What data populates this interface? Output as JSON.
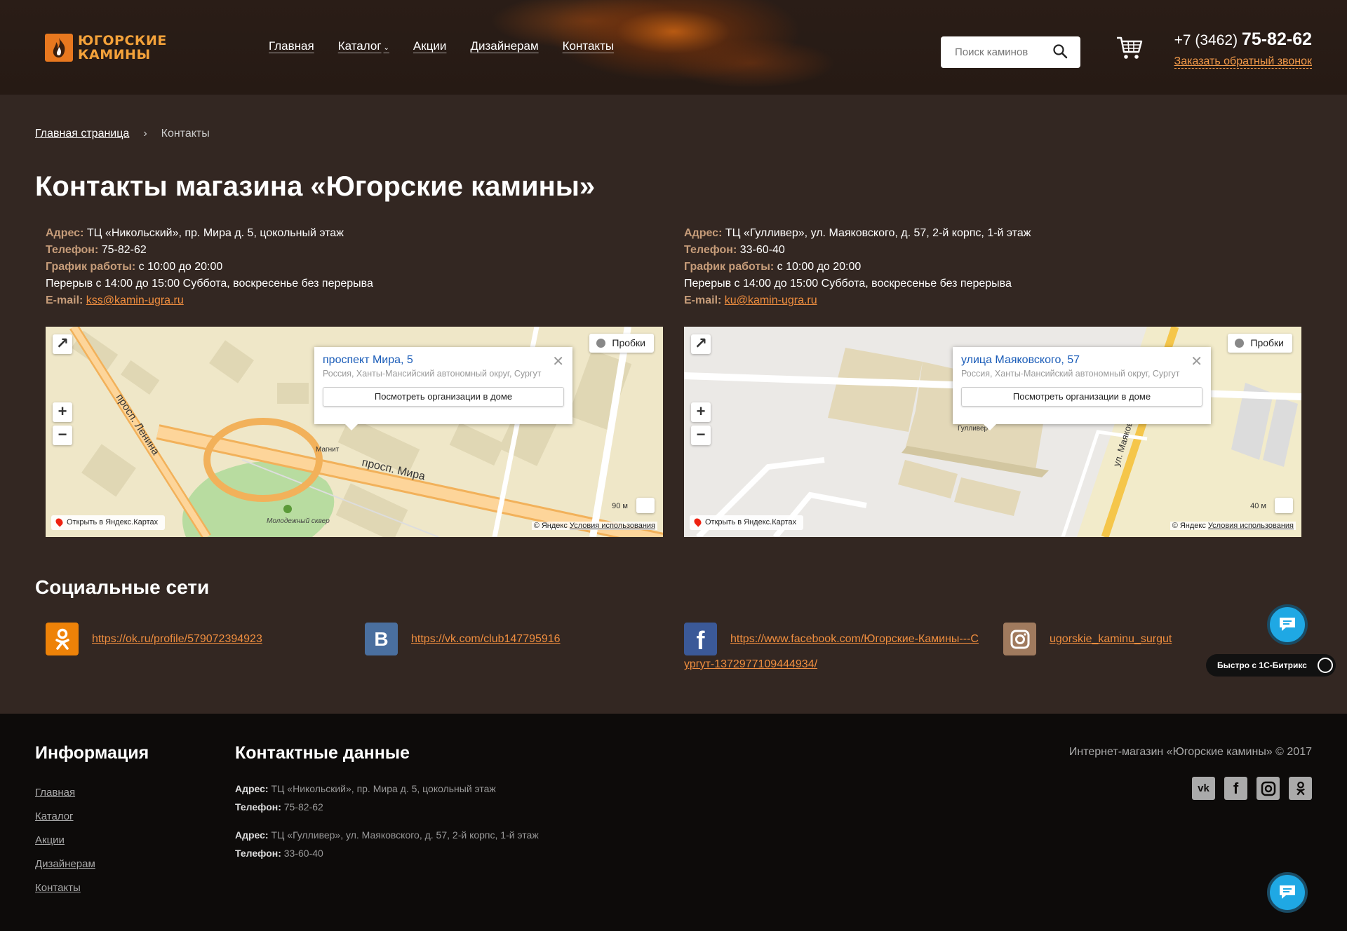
{
  "header": {
    "logo": "ЮГОРСКИЕ КАМИНЫ",
    "nav": [
      "Главная",
      "Каталог",
      "Акции",
      "Дизайнерам",
      "Контакты"
    ],
    "search_placeholder": "Поиск каминов",
    "phone_prefix": "+7 (3462)",
    "phone_main": "75-82-62",
    "callback": "Заказать обратный звонок"
  },
  "breadcrumb": {
    "home": "Главная страница",
    "current": "Контакты"
  },
  "title": "Контакты магазина «Югорские камины»",
  "shops": [
    {
      "address_label": "Адрес:",
      "address": "ТЦ «Никольский», пр. Мира д. 5, цокольный этаж",
      "phone_label": "Телефон:",
      "phone": "75-82-62",
      "hours_label": "График работы:",
      "hours": "с 10:00 до 20:00",
      "break": "Перерыв с 14:00 до 15:00 Суббота, воскресенье без перерыва",
      "email_label": "E-mail:",
      "email": "kss@kamin-ugra.ru",
      "map": {
        "balloon_title": "проспект Мира, 5",
        "balloon_sub": "Россия, Ханты-Мансийский автономный округ, Сургут",
        "balloon_btn": "Посмотреть организации в доме",
        "traffic": "Пробки",
        "open": "Открыть в Яндекс.Картах",
        "copy": "© Яндекс",
        "terms": "Условия использования",
        "scale": "90 м",
        "street1": "просп. Ленина",
        "street2": "просп. Мира",
        "poi1": "Магнит",
        "poi2": "Молодежный сквер"
      }
    },
    {
      "address_label": "Адрес:",
      "address": "ТЦ «Гулливер», ул. Маяковского, д. 57, 2-й корпс, 1-й этаж",
      "phone_label": "Телефон:",
      "phone": "33-60-40",
      "hours_label": "График работы:",
      "hours": "с 10:00 до 20:00",
      "break": "Перерыв с 14:00 до 15:00 Суббота, воскресенье без перерыва",
      "email_label": "E-mail:",
      "email": "ku@kamin-ugra.ru",
      "map": {
        "balloon_title": "улица Маяковского, 57",
        "balloon_sub": "Россия, Ханты-Мансийский автономный округ, Сургут",
        "balloon_btn": "Посмотреть организации в доме",
        "traffic": "Пробки",
        "open": "Открыть в Яндекс.Картах",
        "copy": "© Яндекс",
        "terms": "Условия использования",
        "scale": "40 м",
        "street1": "ул. Маяковского",
        "poi1": "Гулливер"
      }
    }
  ],
  "social": {
    "heading": "Социальные сети",
    "ok": "https://ok.ru/profile/579072394923",
    "vk": "https://vk.com/club147795916",
    "fb": "https://www.facebook.com/Югорские-Камины---Сургут-1372977109444934/",
    "ig": "ugorskie_kaminu_surgut"
  },
  "bitrix": "Быстро с 1С-Битрикс",
  "footer": {
    "info_heading": "Информация",
    "links": [
      "Главная",
      "Каталог",
      "Акции",
      "Дизайнерам",
      "Контакты"
    ],
    "contacts_heading": "Контактные данные",
    "addr_label": "Адрес:",
    "phone_label": "Телефон:",
    "addr1": "ТЦ «Никольский», пр. Мира д. 5, цокольный этаж",
    "phone1": "75-82-62",
    "addr2": "ТЦ «Гулливер», ул. Маяковского, д. 57, 2-й корпс, 1-й этаж",
    "phone2": "33-60-40",
    "copyright": "Интернет-магазин «Югорские камины» © 2017"
  },
  "colors": {
    "bg": "#332722",
    "accent": "#f08e3f",
    "label": "#c79d7a",
    "footer": "#0d0b0a"
  }
}
